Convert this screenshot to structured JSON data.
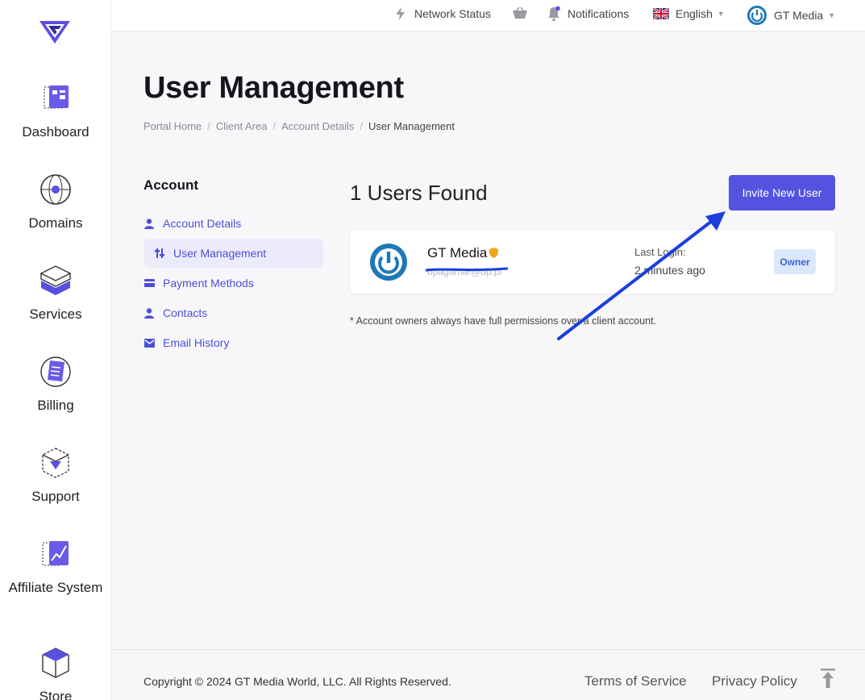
{
  "colors": {
    "accent": "#5353df",
    "link": "#4c4fd8",
    "owner_badge_bg": "#dbe7fb",
    "annotation_arrow": "#1a3fe0"
  },
  "sidebar": {
    "logo_icon": "gt-logo-icon",
    "items": [
      {
        "label": "Dashboard",
        "icon": "dashboard-icon"
      },
      {
        "label": "Domains",
        "icon": "globe-icon"
      },
      {
        "label": "Services",
        "icon": "stack-icon"
      },
      {
        "label": "Billing",
        "icon": "billing-icon"
      },
      {
        "label": "Support",
        "icon": "support-box-icon"
      },
      {
        "label": "Affiliate System",
        "icon": "affiliate-chart-icon"
      },
      {
        "label": "Store",
        "icon": "store-cube-icon"
      }
    ]
  },
  "topbar": {
    "network_status": "Network Status",
    "notifications": "Notifications",
    "language": "English",
    "account_name": "GT Media"
  },
  "page": {
    "title": "User Management",
    "breadcrumb": [
      "Portal Home",
      "Client Area",
      "Account Details",
      "User Management"
    ]
  },
  "account_menu": {
    "heading": "Account",
    "items": [
      {
        "label": "Account Details",
        "icon": "user-icon"
      },
      {
        "label": "User Management",
        "icon": "sliders-icon",
        "active": true
      },
      {
        "label": "Payment Methods",
        "icon": "credit-card-icon"
      },
      {
        "label": "Contacts",
        "icon": "user-icon"
      },
      {
        "label": "Email History",
        "icon": "envelope-icon"
      }
    ]
  },
  "users": {
    "count_text": "1 Users Found",
    "invite_label": "Invite New User",
    "list": [
      {
        "name": "GT Media",
        "email": "bpagamar@op.pl",
        "last_login_label": "Last Login:",
        "last_login_value": "2 minutes ago",
        "role": "Owner"
      }
    ],
    "note": "* Account owners always have full permissions over a client account."
  },
  "footer": {
    "copyright": "Copyright © 2024 GT Media World, LLC. All Rights Reserved.",
    "terms": "Terms of Service",
    "privacy": "Privacy Policy"
  }
}
